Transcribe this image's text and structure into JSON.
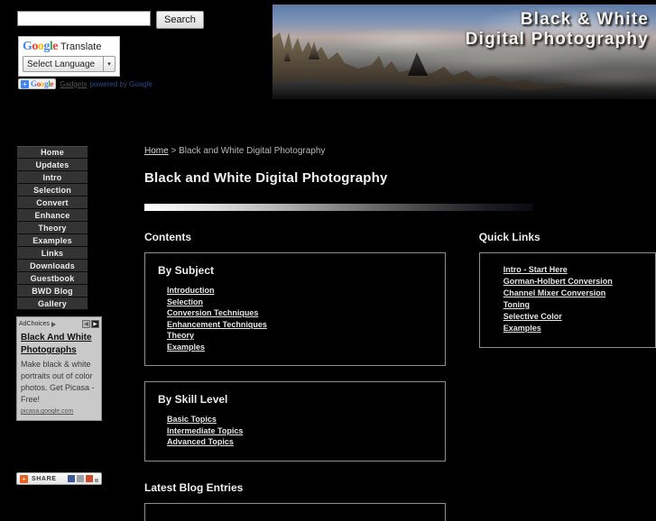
{
  "header": {
    "search": {
      "value": "",
      "placeholder": "",
      "button_label": "Search",
      "icon": "search-icon"
    },
    "translate": {
      "logo_letters": [
        "G",
        "o",
        "o",
        "g",
        "l",
        "e"
      ],
      "word": "Translate",
      "selected_language": "Select Language",
      "chevron": "▾"
    },
    "gadget_bar": {
      "plus": "+",
      "brand": "Google",
      "label": "Gadgets",
      "powered": "powered by Google"
    },
    "banner": {
      "title_line1": "Black & White",
      "title_line2": "Digital Photography",
      "alt": "parliament-hill-banner-image"
    }
  },
  "sidebar": {
    "items": [
      {
        "label": "Home"
      },
      {
        "label": "Updates"
      },
      {
        "label": "Intro"
      },
      {
        "label": "Selection"
      },
      {
        "label": "Convert"
      },
      {
        "label": "Enhance"
      },
      {
        "label": "Theory"
      },
      {
        "label": "Examples"
      },
      {
        "label": "Links"
      },
      {
        "label": "Downloads"
      },
      {
        "label": "Guestbook"
      },
      {
        "label": "BWD Blog"
      },
      {
        "label": "Gallery"
      }
    ],
    "ad": {
      "adchoices_label": "AdChoices",
      "prev_arrow": "◀",
      "next_arrow": "▶",
      "title": "Black And White Photographs",
      "body": "Make black & white portraits out of color photos. Get Picasa - Free!",
      "url": "picasa.google.com"
    },
    "share": {
      "icon": "+",
      "label": "SHARE",
      "icons": [
        "facebook-icon",
        "twitter-icon",
        "email-icon",
        "more-icon"
      ]
    }
  },
  "main": {
    "breadcrumb": {
      "home": "Home",
      "separator": " > ",
      "current": "Black and White Digital Photography"
    },
    "page_title": "Black and White Digital Photography",
    "contents_heading": "Contents",
    "by_subject": {
      "title": "By Subject",
      "links": [
        "Introduction",
        "Selection",
        "Conversion Techniques",
        "Enhancement Techniques",
        "Theory",
        "Examples"
      ]
    },
    "by_skill": {
      "title": "By Skill Level",
      "links": [
        "Basic Topics",
        "Intermediate Topics",
        "Advanced Topics"
      ]
    },
    "blog_heading": "Latest Blog Entries",
    "quick_links": {
      "heading": "Quick Links",
      "links": [
        "Intro - Start Here",
        "Gorman-Holbert Conversion",
        "Channel Mixer Conversion",
        "Toning",
        "Selective Color",
        "Examples"
      ]
    }
  },
  "colors": {
    "page_background": "#000000",
    "nav_button": "#333333",
    "text_primary": "#ececec",
    "panel_border": "#8f8f8f",
    "ad_background": "#c9c9c9",
    "share_orange": "#e8601c"
  }
}
